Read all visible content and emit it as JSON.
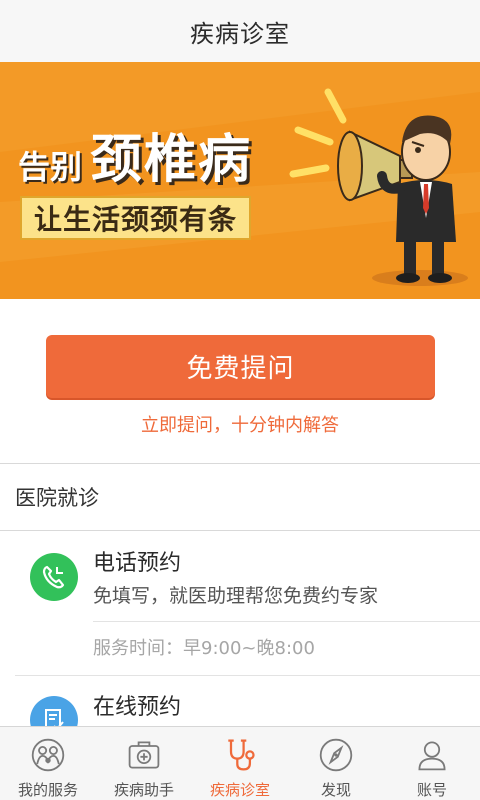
{
  "header": {
    "title": "疾病诊室"
  },
  "banner": {
    "title_prefix": "告别",
    "title_main": "颈椎病",
    "subtitle": "让生活颈颈有条"
  },
  "ask": {
    "button_label": "免费提问",
    "hint": "立即提问，十分钟内解答"
  },
  "section": {
    "title": "医院就诊"
  },
  "services": [
    {
      "title": "电话预约",
      "description": "免填写，就医助理帮您免费约专家",
      "time": "服务时间：早9:00~晚8:00",
      "icon": "phone-icon",
      "color": "#32c15a"
    },
    {
      "title": "在线预约",
      "icon": "form-icon",
      "color": "#4aa3e6"
    }
  ],
  "tabs": [
    {
      "label": "我的服务",
      "icon": "family-icon"
    },
    {
      "label": "疾病助手",
      "icon": "medical-kit-icon"
    },
    {
      "label": "疾病诊室",
      "icon": "stethoscope-icon",
      "active": true
    },
    {
      "label": "发现",
      "icon": "compass-icon"
    },
    {
      "label": "账号",
      "icon": "user-icon"
    }
  ],
  "colors": {
    "accent": "#ef6a3a",
    "banner": "#f2941f",
    "phone": "#32c15a",
    "online": "#4aa3e6"
  }
}
